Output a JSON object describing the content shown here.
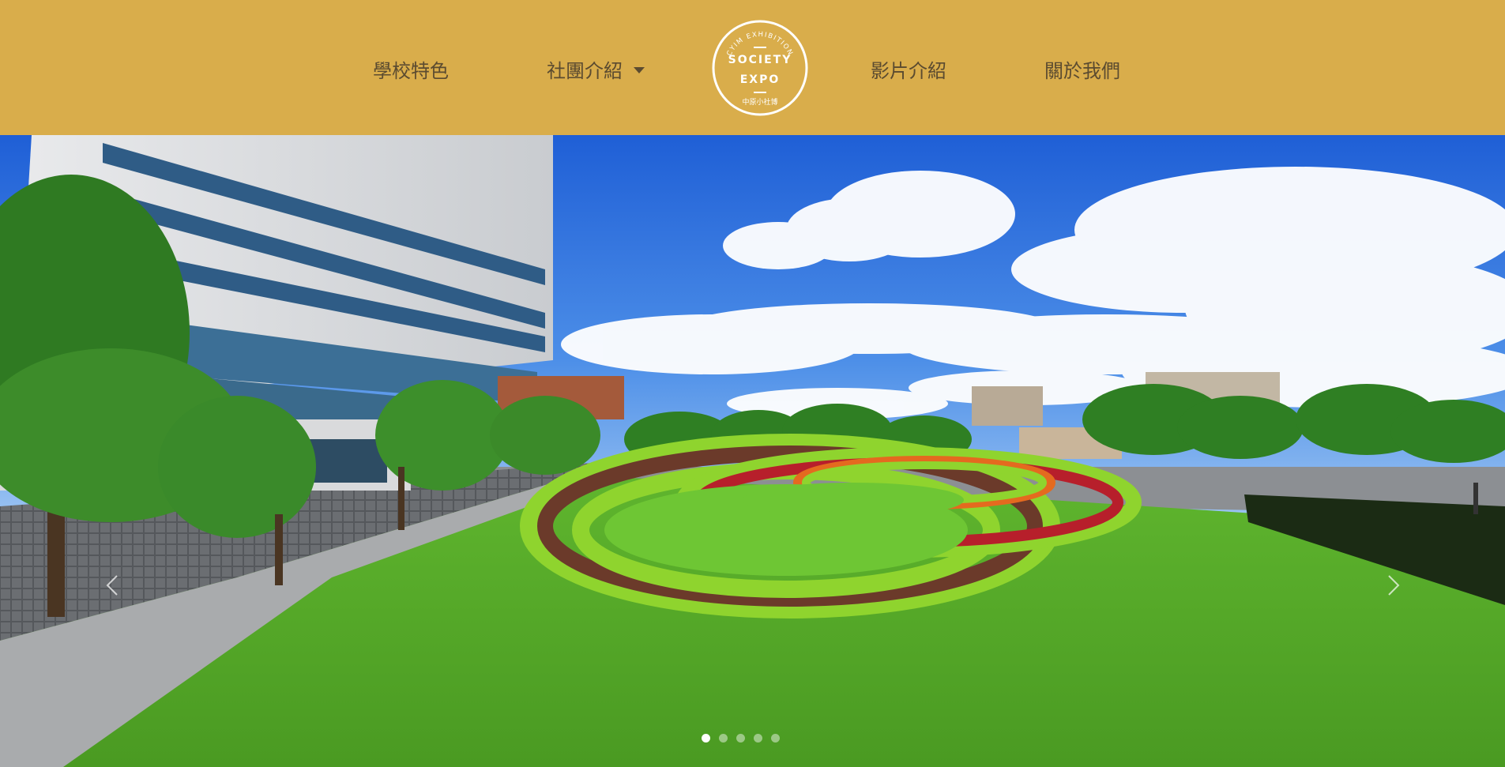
{
  "nav": {
    "items": [
      {
        "label": "學校特色"
      },
      {
        "label": "社團介紹",
        "has_dropdown": true
      },
      {
        "label": "影片介紹"
      },
      {
        "label": "關於我們"
      }
    ]
  },
  "logo": {
    "arc_text": "CYIM EXHIBITION",
    "line1": "SOCIETY",
    "line2": "EXPO",
    "bottom_text": "中原小社博"
  },
  "carousel": {
    "prev_icon": "chevron-left-icon",
    "next_icon": "chevron-right-icon",
    "slide_count": 5,
    "active_slide": 1
  },
  "colors": {
    "navbar": "#d9ad4b",
    "nav_text": "#5b4b30",
    "logo_stroke": "#ffffff"
  }
}
